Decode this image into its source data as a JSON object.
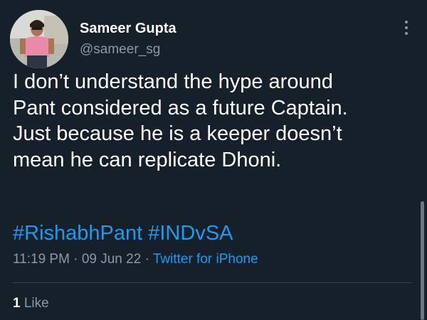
{
  "user": {
    "display_name": "Sameer Gupta",
    "handle": "@sameer_sg"
  },
  "tweet": {
    "lines": [
      "I don’t understand the hype around",
      "Pant considered as a future Captain.",
      "Just because he is a keeper doesn’t",
      "mean he can replicate Dhoni."
    ],
    "hashtags": [
      "#RishabhPant",
      "#INDvSA"
    ],
    "time": "11:19 PM",
    "date": "09 Jun 22",
    "source": "Twitter for iPhone",
    "separator": "·"
  },
  "stats": {
    "likes_count": "1",
    "likes_label": "Like"
  },
  "icons": {
    "more": "more-vertical-icon"
  },
  "colors": {
    "background": "#15202b",
    "primary_text": "#ffffff",
    "secondary_text": "#8b98a5",
    "link": "#1d9bf0",
    "divider": "#38444d"
  }
}
